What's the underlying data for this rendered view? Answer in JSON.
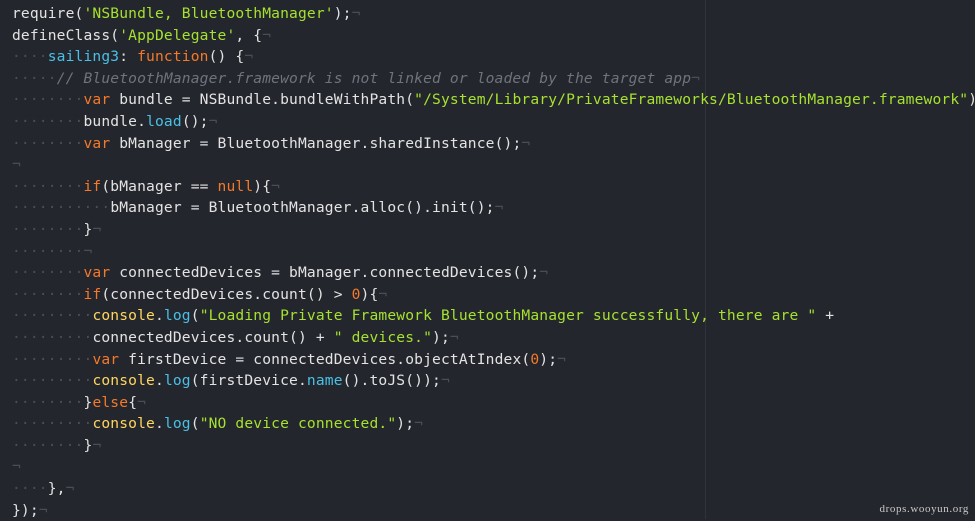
{
  "watermark": "drops.wooyun.org",
  "colors": {
    "background": "#24262d",
    "string": "#a6e22e",
    "keyword": "#f47a2a",
    "function": "#49c0e6",
    "comment": "#6f737c",
    "console": "#ffd75e",
    "plain": "#e3e3e3",
    "invisible": "#4a4d55"
  },
  "code_lines": [
    [
      [
        "plain",
        "require("
      ],
      [
        "str",
        "'NSBundle, BluetoothManager'"
      ],
      [
        "plain",
        ");"
      ],
      [
        "nl",
        "¬"
      ]
    ],
    [
      [
        "plain",
        "defineClass("
      ],
      [
        "str",
        "'AppDelegate'"
      ],
      [
        "plain",
        ", {"
      ],
      [
        "nl",
        "¬"
      ]
    ],
    [
      [
        "ws",
        "····"
      ],
      [
        "fn",
        "sailing3"
      ],
      [
        "plain",
        ": "
      ],
      [
        "kw",
        "function"
      ],
      [
        "plain",
        "() {"
      ],
      [
        "nl",
        "¬"
      ]
    ],
    [
      [
        "ws",
        "·····"
      ],
      [
        "cmt",
        "// BluetoothManager.framework is not linked or loaded by the target app"
      ],
      [
        "nl",
        "¬"
      ]
    ],
    [
      [
        "ws",
        "········"
      ],
      [
        "kw",
        "var"
      ],
      [
        "plain",
        " bundle = NSBundle.bundleWithPath("
      ],
      [
        "str",
        "\"/System/Library/PrivateFrameworks/BluetoothManager.framework\""
      ],
      [
        "plain",
        ");"
      ],
      [
        "nl",
        "¬"
      ]
    ],
    [
      [
        "ws",
        "········"
      ],
      [
        "plain",
        "bundle."
      ],
      [
        "fn",
        "load"
      ],
      [
        "plain",
        "();"
      ],
      [
        "nl",
        "¬"
      ]
    ],
    [
      [
        "ws",
        "········"
      ],
      [
        "kw",
        "var"
      ],
      [
        "plain",
        " bManager = BluetoothManager.sharedInstance();"
      ],
      [
        "nl",
        "¬"
      ]
    ],
    [
      [
        "nl",
        "¬"
      ]
    ],
    [
      [
        "ws",
        "········"
      ],
      [
        "kw",
        "if"
      ],
      [
        "plain",
        "(bManager == "
      ],
      [
        "kw",
        "null"
      ],
      [
        "plain",
        "){"
      ],
      [
        "nl",
        "¬"
      ]
    ],
    [
      [
        "ws",
        "···········"
      ],
      [
        "plain",
        "bManager = BluetoothManager.alloc().init();"
      ],
      [
        "nl",
        "¬"
      ]
    ],
    [
      [
        "ws",
        "········"
      ],
      [
        "plain",
        "}"
      ],
      [
        "nl",
        "¬"
      ]
    ],
    [
      [
        "ws",
        "········"
      ],
      [
        "nl",
        "¬"
      ]
    ],
    [
      [
        "ws",
        "········"
      ],
      [
        "kw",
        "var"
      ],
      [
        "plain",
        " connectedDevices = bManager.connectedDevices();"
      ],
      [
        "nl",
        "¬"
      ]
    ],
    [
      [
        "ws",
        "········"
      ],
      [
        "kw",
        "if"
      ],
      [
        "plain",
        "(connectedDevices.count() > "
      ],
      [
        "num",
        "0"
      ],
      [
        "plain",
        "){"
      ],
      [
        "nl",
        "¬"
      ]
    ],
    [
      [
        "ws",
        "·········"
      ],
      [
        "con",
        "console"
      ],
      [
        "plain",
        "."
      ],
      [
        "fn",
        "log"
      ],
      [
        "plain",
        "("
      ],
      [
        "str",
        "\"Loading Private Framework BluetoothManager successfully, there are \""
      ],
      [
        "plain",
        " +"
      ]
    ],
    [
      [
        "ws",
        "·········"
      ],
      [
        "plain",
        "connectedDevices.count() + "
      ],
      [
        "str",
        "\" devices.\""
      ],
      [
        "plain",
        ");"
      ],
      [
        "nl",
        "¬"
      ]
    ],
    [
      [
        "ws",
        "·········"
      ],
      [
        "kw",
        "var"
      ],
      [
        "plain",
        " firstDevice = connectedDevices.objectAtIndex("
      ],
      [
        "num",
        "0"
      ],
      [
        "plain",
        ");"
      ],
      [
        "nl",
        "¬"
      ]
    ],
    [
      [
        "ws",
        "·········"
      ],
      [
        "con",
        "console"
      ],
      [
        "plain",
        "."
      ],
      [
        "fn",
        "log"
      ],
      [
        "plain",
        "(firstDevice."
      ],
      [
        "fn",
        "name"
      ],
      [
        "plain",
        "().toJS());"
      ],
      [
        "nl",
        "¬"
      ]
    ],
    [
      [
        "ws",
        "········"
      ],
      [
        "plain",
        "}"
      ],
      [
        "kw",
        "else"
      ],
      [
        "plain",
        "{"
      ],
      [
        "nl",
        "¬"
      ]
    ],
    [
      [
        "ws",
        "·········"
      ],
      [
        "con",
        "console"
      ],
      [
        "plain",
        "."
      ],
      [
        "fn",
        "log"
      ],
      [
        "plain",
        "("
      ],
      [
        "str",
        "\"NO device connected.\""
      ],
      [
        "plain",
        ");"
      ],
      [
        "nl",
        "¬"
      ]
    ],
    [
      [
        "ws",
        "········"
      ],
      [
        "plain",
        "}"
      ],
      [
        "nl",
        "¬"
      ]
    ],
    [
      [
        "nl",
        "¬"
      ]
    ],
    [
      [
        "ws",
        "····"
      ],
      [
        "plain",
        "},"
      ],
      [
        "nl",
        "¬"
      ]
    ],
    [
      [
        "plain",
        "});"
      ],
      [
        "nl",
        "¬"
      ]
    ]
  ]
}
